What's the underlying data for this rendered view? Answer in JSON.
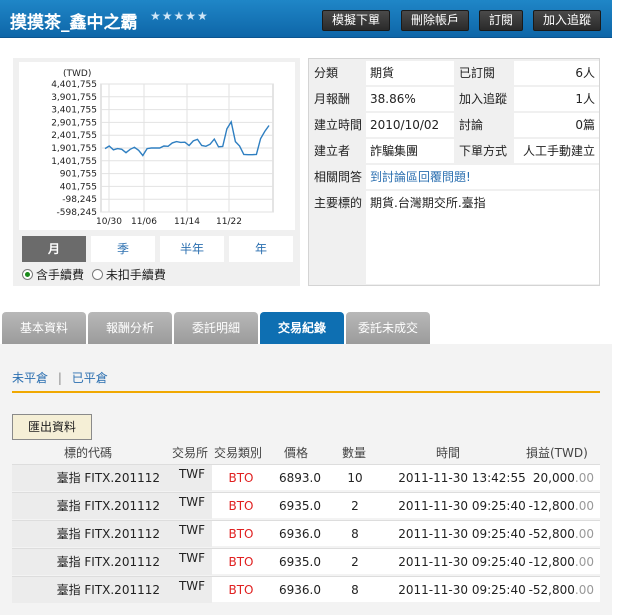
{
  "header": {
    "title": "摸摸茶_鑫中之霸",
    "stars": "★★★★★",
    "buttons": [
      "模擬下單",
      "刪除帳戶",
      "訂閱",
      "加入追蹤"
    ]
  },
  "chart": {
    "unit": "(TWD)",
    "period_tabs": [
      "月",
      "季",
      "半年",
      "年"
    ],
    "active_period": "月",
    "radio_include_fee": "含手續費",
    "radio_exclude_fee": "未扣手續費",
    "selected_radio": "含手續費"
  },
  "chart_data": {
    "type": "line",
    "ylim": [
      -598245,
      4401755
    ],
    "ytick_labels": [
      "4,401,755",
      "3,901,755",
      "3,401,755",
      "2,901,755",
      "2,401,755",
      "1,901,755",
      "1,401,755",
      "901,755",
      "401,755",
      "-98,245",
      "-598,245"
    ],
    "ytick_values": [
      4401755,
      3901755,
      3401755,
      2901755,
      2401755,
      1901755,
      1401755,
      901755,
      401755,
      -98245,
      -598245
    ],
    "xtick_labels": [
      "10/30",
      "11/06",
      "11/14",
      "11/22"
    ],
    "series": [
      {
        "values": [
          1880000,
          1980000,
          1830000,
          1880000,
          1850000,
          1720000,
          1850000,
          1930000,
          1810000,
          1610000,
          1880000,
          1900000,
          1900000,
          1900000,
          1980000,
          1970000,
          2100000,
          2150000,
          2120000,
          2130000,
          2000000,
          2180000,
          2240000,
          2000000,
          1970000,
          2050000,
          2250000,
          1950000,
          1960000,
          2650000,
          2920000,
          2150000,
          1980000,
          1650000,
          1640000,
          1640000,
          1650000,
          2270000,
          2550000,
          2780000
        ]
      }
    ]
  },
  "info": {
    "category_label": "分類",
    "category_value": "期貨",
    "subscribed_label": "已訂閱",
    "subscribed_value": "6人",
    "monthly_return_label": "月報酬",
    "monthly_return_value": "38.86%",
    "tracking_label": "加入追蹤",
    "tracking_value": "1人",
    "created_time_label": "建立時間",
    "created_time_value": "2010/10/02",
    "discussion_label": "討論",
    "discussion_value": "0篇",
    "creator_label": "建立者",
    "creator_value": "詐騙集團",
    "order_method_label": "下單方式",
    "order_method_value": "人工手動建立",
    "qa_label": "相關問答",
    "qa_link": "到討論區回覆問題!",
    "main_target_label": "主要標的",
    "main_target_value": "期貨.台灣期交所.臺指"
  },
  "tabs": [
    "基本資料",
    "報酬分析",
    "委託明細",
    "交易紀錄",
    "委託未成交"
  ],
  "active_tab": "交易紀錄",
  "sub_links": {
    "open": "未平倉",
    "sep": "|",
    "closed": "已平倉"
  },
  "export_label": "匯出資料",
  "table": {
    "headers": [
      "標的代碼",
      "交易所",
      "交易類別",
      "價格",
      "數量",
      "時間",
      "損益(TWD)"
    ],
    "rows": [
      {
        "code": "臺指 FITX.201112",
        "exchange": "TWF",
        "type": "BTO",
        "price": "6893.0",
        "qty": "10",
        "time": "2011-11-30 13:42:55",
        "pnl": "20,000",
        "pnl_dec": ".00"
      },
      {
        "code": "臺指 FITX.201112",
        "exchange": "TWF",
        "type": "BTO",
        "price": "6935.0",
        "qty": "2",
        "time": "2011-11-30 09:25:40",
        "pnl": "-12,800",
        "pnl_dec": ".00"
      },
      {
        "code": "臺指 FITX.201112",
        "exchange": "TWF",
        "type": "BTO",
        "price": "6936.0",
        "qty": "8",
        "time": "2011-11-30 09:25:40",
        "pnl": "-52,800",
        "pnl_dec": ".00"
      },
      {
        "code": "臺指 FITX.201112",
        "exchange": "TWF",
        "type": "BTO",
        "price": "6935.0",
        "qty": "2",
        "time": "2011-11-30 09:25:40",
        "pnl": "-12,800",
        "pnl_dec": ".00"
      },
      {
        "code": "臺指 FITX.201112",
        "exchange": "TWF",
        "type": "BTO",
        "price": "6936.0",
        "qty": "8",
        "time": "2011-11-30 09:25:40",
        "pnl": "-52,800",
        "pnl_dec": ".00"
      }
    ]
  }
}
